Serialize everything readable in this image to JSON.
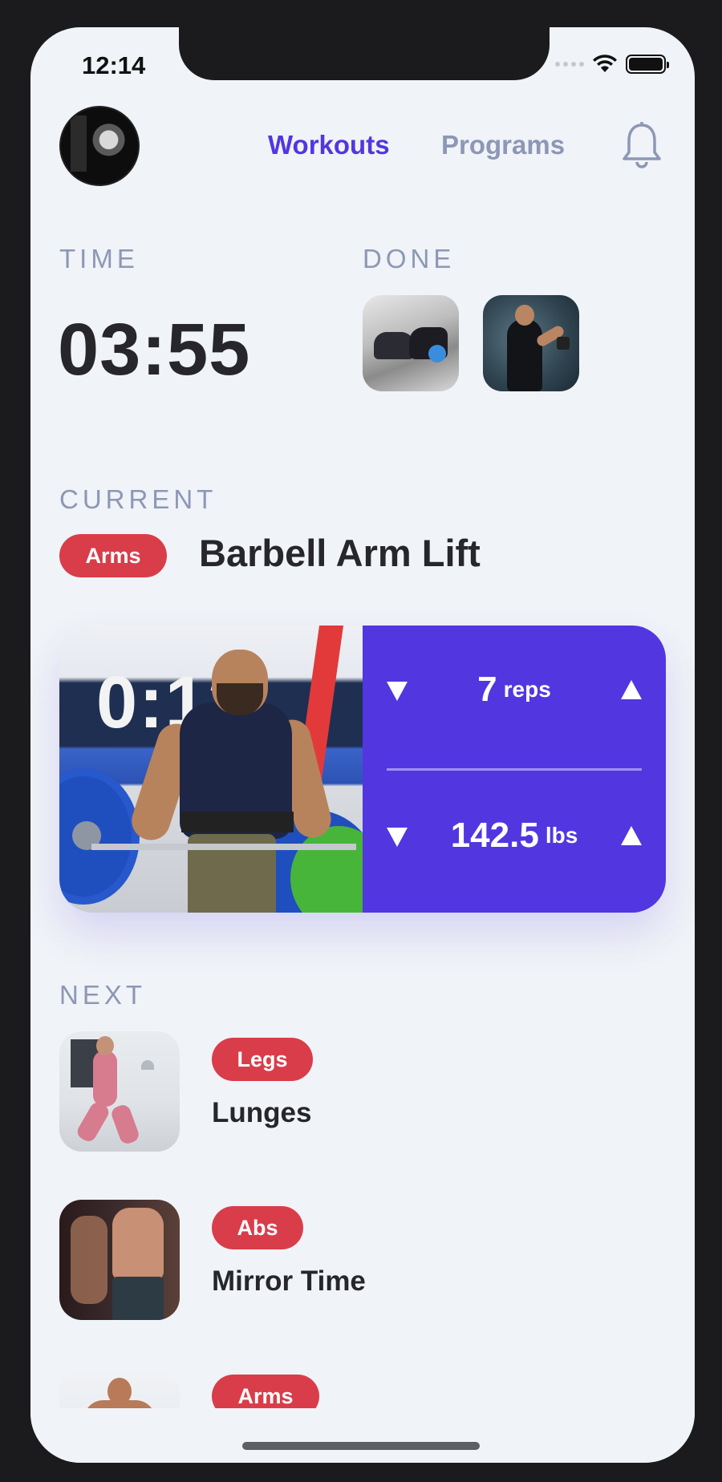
{
  "status_bar": {
    "time": "12:14"
  },
  "header": {
    "tabs": [
      {
        "label": "Workouts",
        "active": true
      },
      {
        "label": "Programs",
        "active": false
      }
    ],
    "icons": {
      "avatar": "user-avatar",
      "notifications": "bell-icon"
    }
  },
  "session": {
    "time_label": "TIME",
    "time_value": "03:55",
    "done_label": "DONE",
    "done_items": [
      "situp-workout-thumbnail",
      "dumbbell-curl-thumbnail"
    ]
  },
  "current": {
    "label": "CURRENT",
    "tag": "Arms",
    "title": "Barbell Arm Lift",
    "reps_value": "7",
    "reps_unit": "reps",
    "weight_value": "142.5",
    "weight_unit": "lbs"
  },
  "next": {
    "label": "NEXT",
    "items": [
      {
        "tag": "Legs",
        "name": "Lunges"
      },
      {
        "tag": "Abs",
        "name": "Mirror Time"
      },
      {
        "tag": "Arms",
        "name": ""
      }
    ]
  },
  "colors": {
    "accent": "#5236e0",
    "tag_red": "#d93d4a",
    "muted": "#8d97b6",
    "background": "#f0f3f7",
    "text_dark": "#26262b"
  }
}
